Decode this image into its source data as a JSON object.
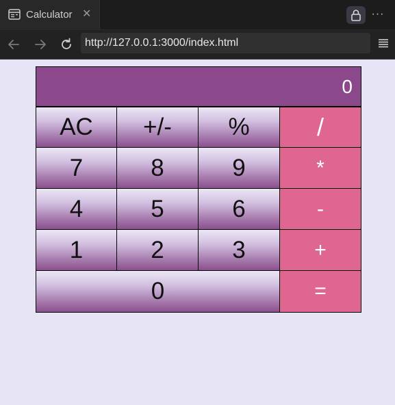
{
  "browser": {
    "tab_title": "Calculator",
    "tab_close": "✕",
    "url": "http://127.0.0.1:3000/index.html",
    "more": "···"
  },
  "calculator": {
    "display": "0",
    "keys": {
      "ac": "AC",
      "sign": "+/-",
      "percent": "%",
      "divide": "/",
      "seven": "7",
      "eight": "8",
      "nine": "9",
      "multiply": "*",
      "four": "4",
      "five": "5",
      "six": "6",
      "subtract": "-",
      "one": "1",
      "two": "2",
      "three": "3",
      "add": "+",
      "zero": "0",
      "equals": "="
    },
    "colors": {
      "display_bg": "#8b498c",
      "operator_bg": "#de6690",
      "page_bg": "#e6e3f5"
    }
  }
}
